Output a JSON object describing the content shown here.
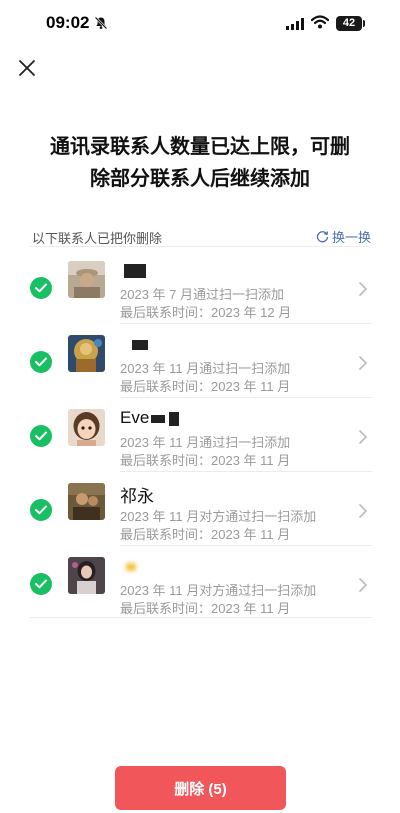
{
  "status_bar": {
    "time": "09:02",
    "battery": "42"
  },
  "title_lines": [
    "通讯录联系人数量已达上限，可删",
    "除部分联系人后继续添加"
  ],
  "section": {
    "label": "以下联系人已把你删除",
    "refresh_label": "换一换"
  },
  "contacts": [
    {
      "name": "",
      "line2": "2023 年 7 月通过扫一扫添加",
      "line3": "最后联系时间：2023 年 12 月",
      "selected": true
    },
    {
      "name": "",
      "line2": "2023 年 11 月通过扫一扫添加",
      "line3": "最后联系时间：2023 年 11 月",
      "selected": true
    },
    {
      "name": "Eve",
      "line2": "2023 年 11 月通过扫一扫添加",
      "line3": "最后联系时间：2023 年 11 月",
      "selected": true
    },
    {
      "name": "祁永",
      "line2": "2023 年 11 月对方通过扫一扫添加",
      "line3": "最后联系时间：2023 年 11 月",
      "selected": true
    },
    {
      "name": "",
      "line2": "2023 年 11 月对方通过扫一扫添加",
      "line3": "最后联系时间：2023 年 11 月",
      "selected": true
    }
  ],
  "delete_button": {
    "label": "删除 (5)"
  },
  "colors": {
    "accent_green": "#18c063",
    "danger": "#f0565a",
    "link_blue": "#4a6fb0"
  }
}
